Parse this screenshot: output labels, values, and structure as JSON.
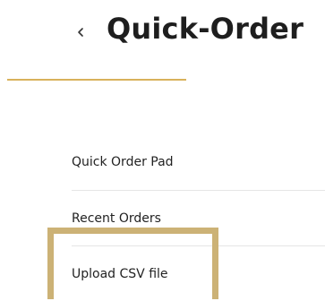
{
  "header": {
    "back_symbol": "‹",
    "back_icon": "chevron-left-icon",
    "title": "Quick-Order"
  },
  "menu": {
    "items": [
      {
        "label": "Quick Order Pad"
      },
      {
        "label": "Recent Orders"
      },
      {
        "label": "Upload CSV file",
        "highlighted": true
      }
    ]
  },
  "colors": {
    "accent_gold": "#d8b25b",
    "highlight_border": "#ccb276",
    "text": "#222222",
    "divider": "#e5e5e5"
  }
}
